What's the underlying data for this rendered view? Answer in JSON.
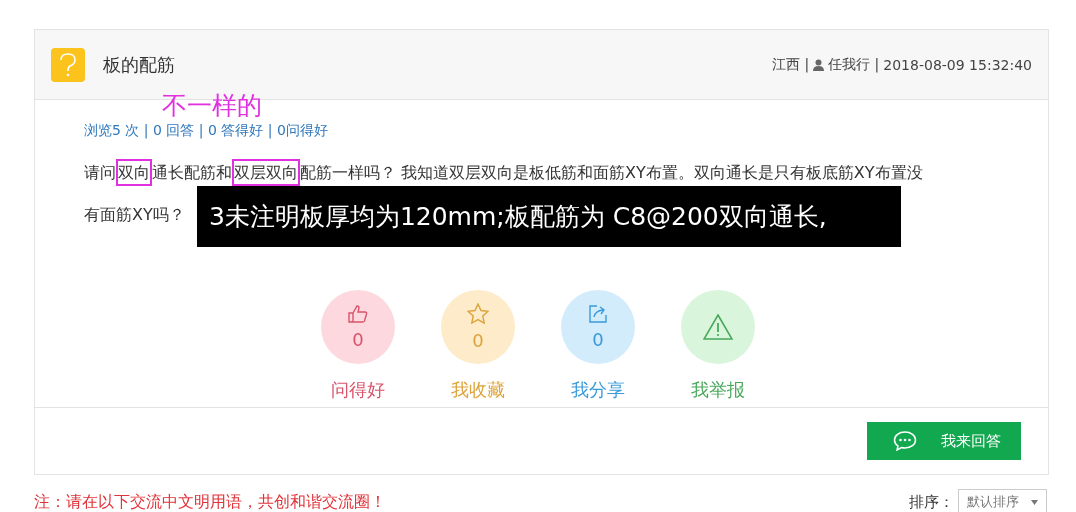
{
  "question": {
    "title": "板的配筋",
    "region": "江西 |",
    "author": "任我行 |",
    "time": "2018-08-09 15:32:40",
    "stats": "浏览5 次 | 0 回答 | 0 答得好 | 0问得好",
    "body": [
      {
        "text": "请问",
        "boxed": false
      },
      {
        "text": "双向",
        "boxed": true
      },
      {
        "text": "通长配筋和",
        "boxed": false
      },
      {
        "text": "双层双向",
        "boxed": true
      },
      {
        "text": "配筋一样吗？ 我知道双层双向是板低筋和面筋XY布置。双向通长是只有板底筋XY布置没有面筋XY吗？",
        "boxed": false
      }
    ]
  },
  "annotation": {
    "note": "不一样的",
    "excerpt": "3未注明板厚均为120mm;板配筋为 C8@200双向通长,"
  },
  "actions": [
    {
      "kind": "like",
      "count": "0",
      "label": "问得好"
    },
    {
      "kind": "favorite",
      "count": "0",
      "label": "我收藏"
    },
    {
      "kind": "share",
      "count": "0",
      "label": "我分享"
    },
    {
      "kind": "report",
      "label": "我举报"
    }
  ],
  "answer_button": "我来回答",
  "footer": {
    "notice": "注：请在以下交流中文明用语，共创和谐交流圈！",
    "sort_label": "排序：",
    "sort_value": "默认排序"
  }
}
